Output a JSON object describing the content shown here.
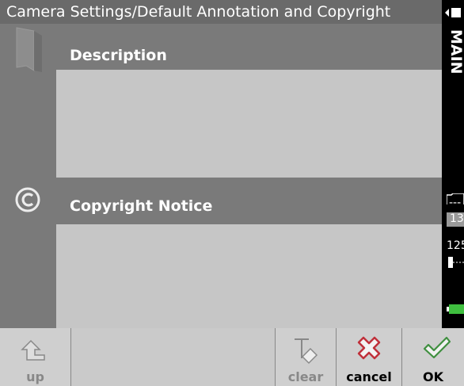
{
  "window": {
    "title": "Camera Settings/Default Annotation and Copyright"
  },
  "sections": {
    "description": {
      "label": "Description",
      "value": "",
      "icon": "document-icon"
    },
    "copyright": {
      "label": "Copyright Notice",
      "value": "",
      "icon": "copyright-icon"
    }
  },
  "sidebar": {
    "main_label": "MAIN",
    "folder_top": "---",
    "folder_number": "13",
    "shutter_value": "125"
  },
  "toolbar": {
    "up_label": "up",
    "clear_label": "clear",
    "cancel_label": "cancel",
    "ok_label": "OK"
  },
  "colors": {
    "panel": "#7a7a7a",
    "title_bar": "#6a6a6a",
    "text_box": "#c6c6c6",
    "battery": "#3fbf3f",
    "ok_check": "#3f8f3f",
    "cancel_x": "#c0303a"
  }
}
